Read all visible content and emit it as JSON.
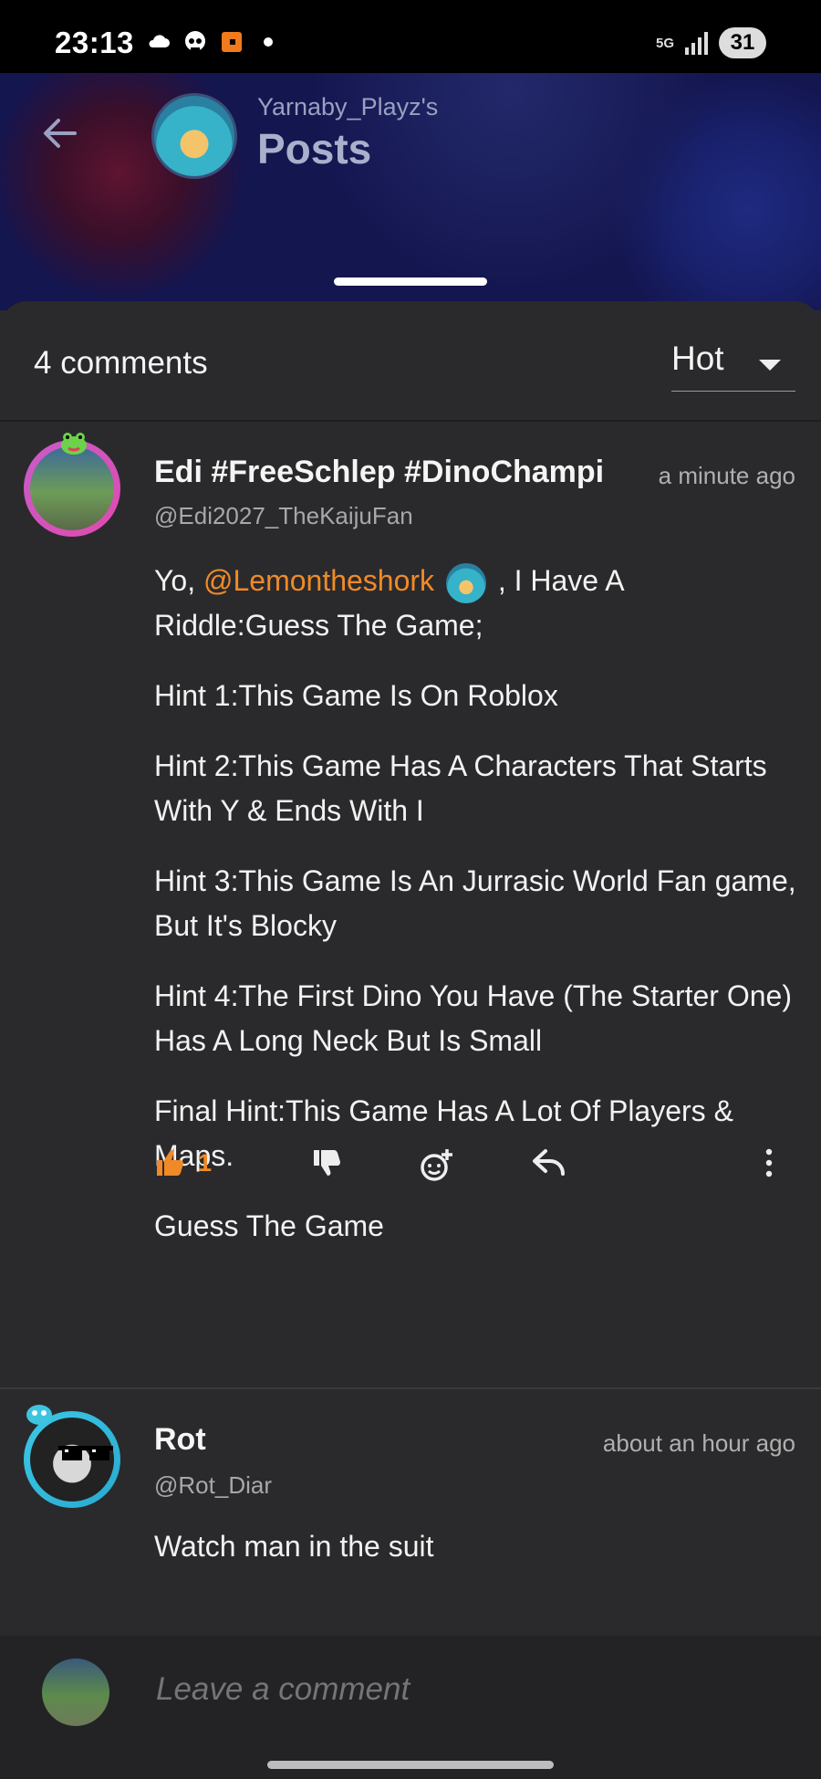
{
  "status_bar": {
    "time": "23:13",
    "network": "5G",
    "battery": "31"
  },
  "header": {
    "subtitle": "Yarnaby_Playz's",
    "title": "Posts"
  },
  "comments_header": {
    "count_label": "4 comments",
    "sort_label": "Hot"
  },
  "comments": [
    {
      "username": "Edi #FreeSchlep #DinoChampi",
      "handle": "@Edi2027_TheKaijuFan",
      "time": "a minute ago",
      "line1_prefix": "Yo, ",
      "mention": "@Lemontheshork",
      "line1_suffix": " , I Have A Riddle:Guess The Game;",
      "paragraphs": [
        "Hint 1:This Game Is On Roblox",
        "Hint 2:This Game Has A Characters That Starts With Y & Ends With I",
        "Hint 3:This Game Is An Jurrasic World Fan game, But It's Blocky",
        "Hint 4:The First Dino You Have (The Starter One) Has A Long Neck But Is Small",
        "Final Hint:This Game Has A Lot Of Players & Maps.",
        "Guess The Game"
      ],
      "likes": "1"
    },
    {
      "username": "Rot",
      "handle": "@Rot_Diar",
      "time": "about an hour ago",
      "text": "Watch man in the suit"
    }
  ],
  "composer": {
    "placeholder": "Leave a comment"
  },
  "colors": {
    "accent": "#f08a28",
    "sheet": "#2a2a2c",
    "status_bar": "#000000"
  }
}
